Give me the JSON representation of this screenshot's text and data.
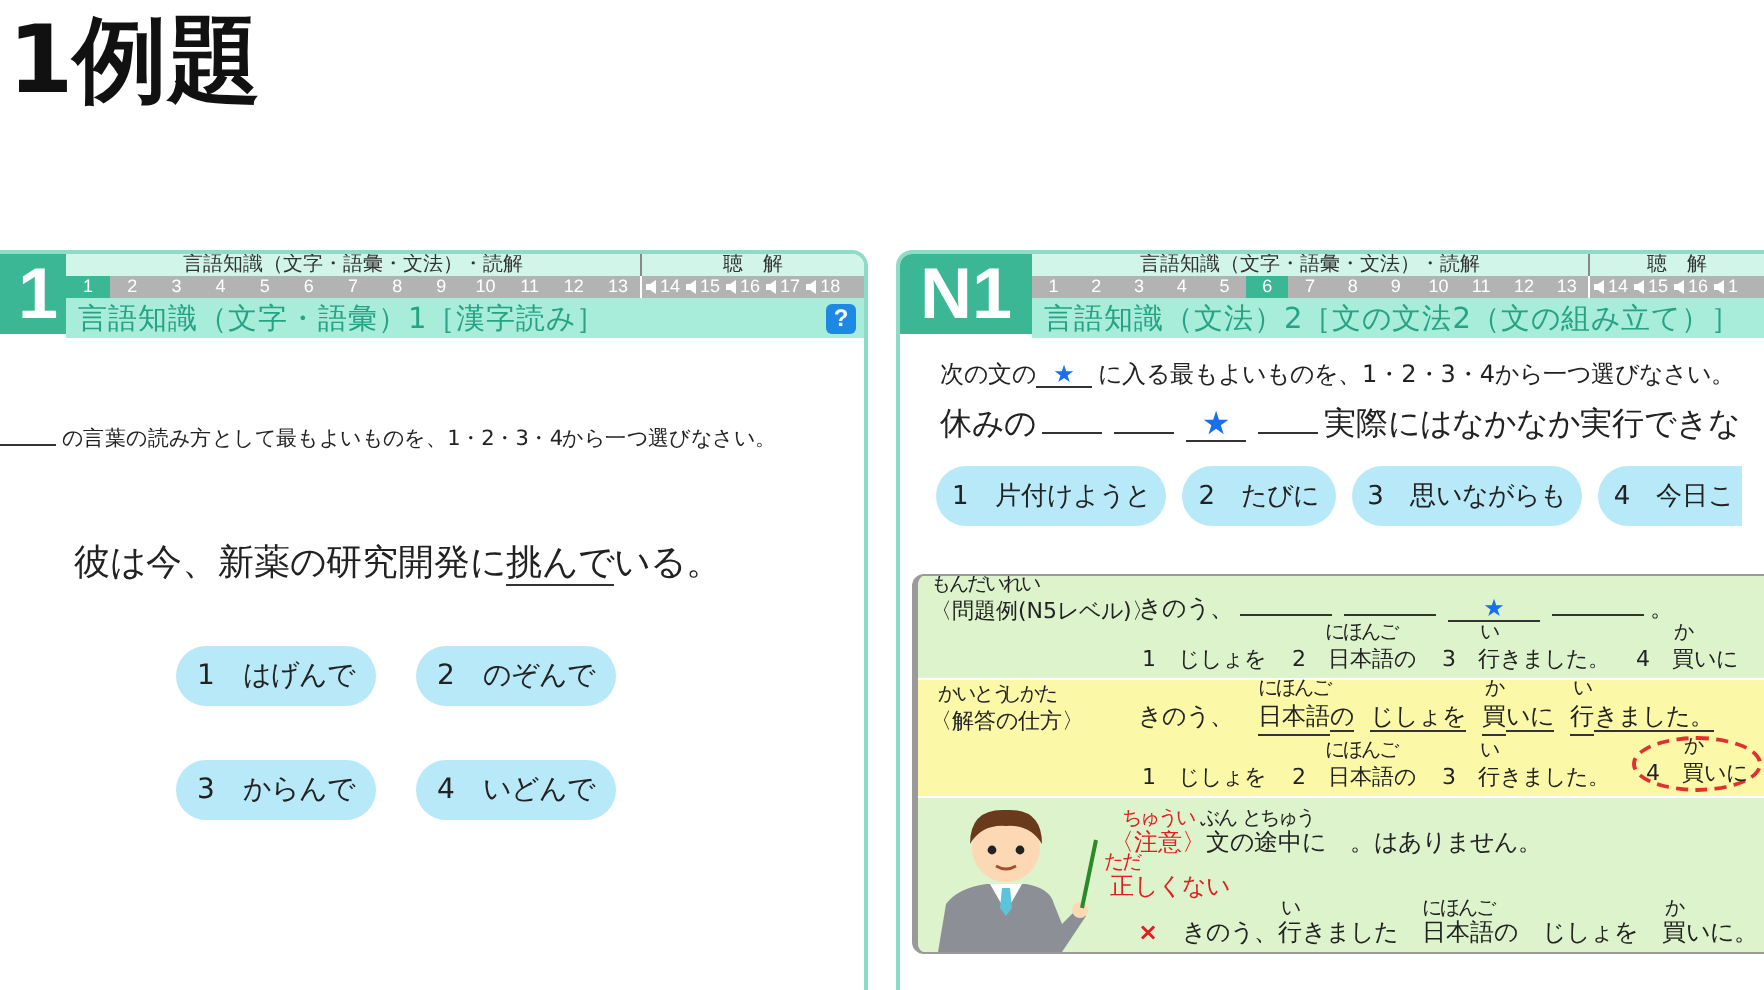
{
  "page_title": "1例題",
  "left_panel": {
    "logo": "1",
    "section_label": "言語知識（文字・語彙・文法）・読解",
    "listening_label": "聴　解",
    "numbers": [
      {
        "label": "1",
        "selected": true
      },
      {
        "label": "2",
        "selected": false
      },
      {
        "label": "3",
        "selected": false
      },
      {
        "label": "4",
        "selected": false
      },
      {
        "label": "5",
        "selected": false
      },
      {
        "label": "6",
        "selected": false
      },
      {
        "label": "7",
        "selected": false
      },
      {
        "label": "8",
        "selected": false
      },
      {
        "label": "9",
        "selected": false
      },
      {
        "label": "10",
        "selected": false
      },
      {
        "label": "11",
        "selected": false
      },
      {
        "label": "12",
        "selected": false
      },
      {
        "label": "13",
        "selected": false
      }
    ],
    "audio_numbers": [
      "14",
      "15",
      "16",
      "17",
      "18"
    ],
    "title": "言語知識（文字・語彙）1［漢字読み］",
    "help": "?",
    "instruction": [
      {
        "kind": "blank"
      },
      {
        "kind": "text",
        "text": "の言葉の読み方として最もよいものを、1・2・3・4から一つ選びなさい。"
      }
    ],
    "sentence": [
      {
        "kind": "text",
        "text": "彼は今、新薬の研究開発に"
      },
      {
        "kind": "text",
        "text": "挑んで",
        "underline": true
      },
      {
        "kind": "text",
        "text": "いる。"
      }
    ],
    "options": [
      "1　はげんで",
      "2　のぞんで",
      "3　からんで",
      "4　いどんで"
    ]
  },
  "right_panel": {
    "logo": "N1",
    "section_label": "言語知識（文字・語彙・文法）・読解",
    "listening_label": "聴　解",
    "numbers": [
      {
        "label": "1",
        "selected": false
      },
      {
        "label": "2",
        "selected": false
      },
      {
        "label": "3",
        "selected": false
      },
      {
        "label": "4",
        "selected": false
      },
      {
        "label": "5",
        "selected": false
      },
      {
        "label": "6",
        "selected": true
      },
      {
        "label": "7",
        "selected": false
      },
      {
        "label": "8",
        "selected": false
      },
      {
        "label": "9",
        "selected": false
      },
      {
        "label": "10",
        "selected": false
      },
      {
        "label": "11",
        "selected": false
      },
      {
        "label": "12",
        "selected": false
      },
      {
        "label": "13",
        "selected": false
      }
    ],
    "audio_numbers": [
      "14",
      "15",
      "16",
      "1"
    ],
    "title": "言語知識（文法）2［文の文法2（文の組み立て）］",
    "instruction": [
      {
        "kind": "text",
        "text": "次の文の"
      },
      {
        "kind": "star",
        "text": "★"
      },
      {
        "kind": "text",
        "text": "に入る最もよいものを、1・2・3・4から一つ選びなさい。"
      }
    ],
    "sentence": [
      {
        "kind": "text",
        "text": "休みの"
      },
      {
        "kind": "blank"
      },
      {
        "kind": "blank"
      },
      {
        "kind": "star",
        "text": "★"
      },
      {
        "kind": "blank"
      },
      {
        "kind": "text",
        "text": "実際にはなかなか実行できな"
      }
    ],
    "options": [
      "1　片付けようと",
      "2　たびに",
      "3　思いながらも",
      "4　今日こ"
    ],
    "example": [
      {
        "kind": "problem",
        "label": [
          {
            "kind": "text",
            "text": "〈"
          },
          {
            "kind": "text",
            "text": "問題例",
            "ruby": "もんだいれい"
          },
          {
            "kind": "text",
            "text": "(N5レベル)〉"
          }
        ],
        "sentence": [
          {
            "kind": "text",
            "text": "きのう、"
          },
          {
            "kind": "blank"
          },
          {
            "kind": "blank"
          },
          {
            "kind": "star",
            "text": "★"
          },
          {
            "kind": "blank"
          },
          {
            "kind": "text",
            "text": "。"
          }
        ],
        "options": [
          {
            "circled": false,
            "parts": [
              {
                "kind": "text",
                "text": "1　じしょを"
              }
            ]
          },
          {
            "circled": false,
            "parts": [
              {
                "kind": "text",
                "text": "2　"
              },
              {
                "kind": "text",
                "text": "日本語",
                "ruby": "にほんご"
              },
              {
                "kind": "text",
                "text": "の"
              }
            ]
          },
          {
            "circled": false,
            "parts": [
              {
                "kind": "text",
                "text": "3　"
              },
              {
                "kind": "text",
                "text": "行",
                "ruby": "い"
              },
              {
                "kind": "text",
                "text": "きました。"
              }
            ]
          },
          {
            "circled": false,
            "parts": [
              {
                "kind": "text",
                "text": "4　"
              },
              {
                "kind": "text",
                "text": "買",
                "ruby": "か"
              },
              {
                "kind": "text",
                "text": "いに"
              }
            ]
          }
        ]
      },
      {
        "kind": "answer",
        "label": [
          {
            "kind": "text",
            "text": "〈"
          },
          {
            "kind": "text",
            "text": "解答",
            "ruby": "かいとう"
          },
          {
            "kind": "text",
            "text": "の仕方",
            "ruby": "しかた"
          },
          {
            "kind": "text",
            "text": "〉"
          }
        ],
        "sentence": [
          {
            "kind": "text",
            "text": "きのう、　"
          },
          {
            "kind": "text",
            "text": "日本語",
            "ruby": "にほんご",
            "underline": true
          },
          {
            "kind": "text",
            "text": "の",
            "underline": true
          },
          {
            "kind": "gap"
          },
          {
            "kind": "text",
            "text": "じしょを",
            "underline": true
          },
          {
            "kind": "gap"
          },
          {
            "kind": "text",
            "text": "買",
            "ruby": "か",
            "underline": true
          },
          {
            "kind": "text",
            "text": "いに",
            "underline": true
          },
          {
            "kind": "gap"
          },
          {
            "kind": "text",
            "text": "行",
            "ruby": "い",
            "underline": true
          },
          {
            "kind": "text",
            "text": "きました。",
            "underline": true
          }
        ],
        "options": [
          {
            "circled": false,
            "parts": [
              {
                "kind": "text",
                "text": "1　じしょを"
              }
            ]
          },
          {
            "circled": false,
            "parts": [
              {
                "kind": "text",
                "text": "2　"
              },
              {
                "kind": "text",
                "text": "日本語",
                "ruby": "にほんご"
              },
              {
                "kind": "text",
                "text": "の"
              }
            ]
          },
          {
            "circled": false,
            "parts": [
              {
                "kind": "text",
                "text": "3　"
              },
              {
                "kind": "text",
                "text": "行",
                "ruby": "い"
              },
              {
                "kind": "text",
                "text": "きました。"
              }
            ]
          },
          {
            "circled": true,
            "parts": [
              {
                "kind": "text",
                "text": "4　"
              },
              {
                "kind": "text",
                "text": "買",
                "ruby": "か"
              },
              {
                "kind": "text",
                "text": "いに"
              }
            ]
          }
        ]
      },
      {
        "kind": "notice",
        "note": [
          {
            "kind": "note",
            "text": "〈"
          },
          {
            "kind": "note",
            "text": "注意",
            "ruby": "ちゅうい"
          },
          {
            "kind": "note",
            "text": "〉"
          },
          {
            "kind": "text",
            "text": "文",
            "ruby": "ぶん"
          },
          {
            "kind": "text",
            "text": "の"
          },
          {
            "kind": "text",
            "text": "途中",
            "ruby": "とちゅう"
          },
          {
            "kind": "text",
            "text": "に　。はありません。"
          }
        ],
        "wrong_label": [
          {
            "kind": "note",
            "text": "正",
            "ruby": "ただ"
          },
          {
            "kind": "note",
            "text": "しくない"
          }
        ],
        "wrong_example": [
          {
            "kind": "cross",
            "text": "×"
          },
          {
            "kind": "text",
            "text": "　きのう、"
          },
          {
            "kind": "text",
            "text": "行",
            "ruby": "い"
          },
          {
            "kind": "text",
            "text": "きました　"
          },
          {
            "kind": "text",
            "text": "日本語",
            "ruby": "にほんご"
          },
          {
            "kind": "text",
            "text": "の　じしょを　"
          },
          {
            "kind": "text",
            "text": "買",
            "ruby": "か"
          },
          {
            "kind": "text",
            "text": "いに。"
          }
        ]
      }
    ]
  }
}
